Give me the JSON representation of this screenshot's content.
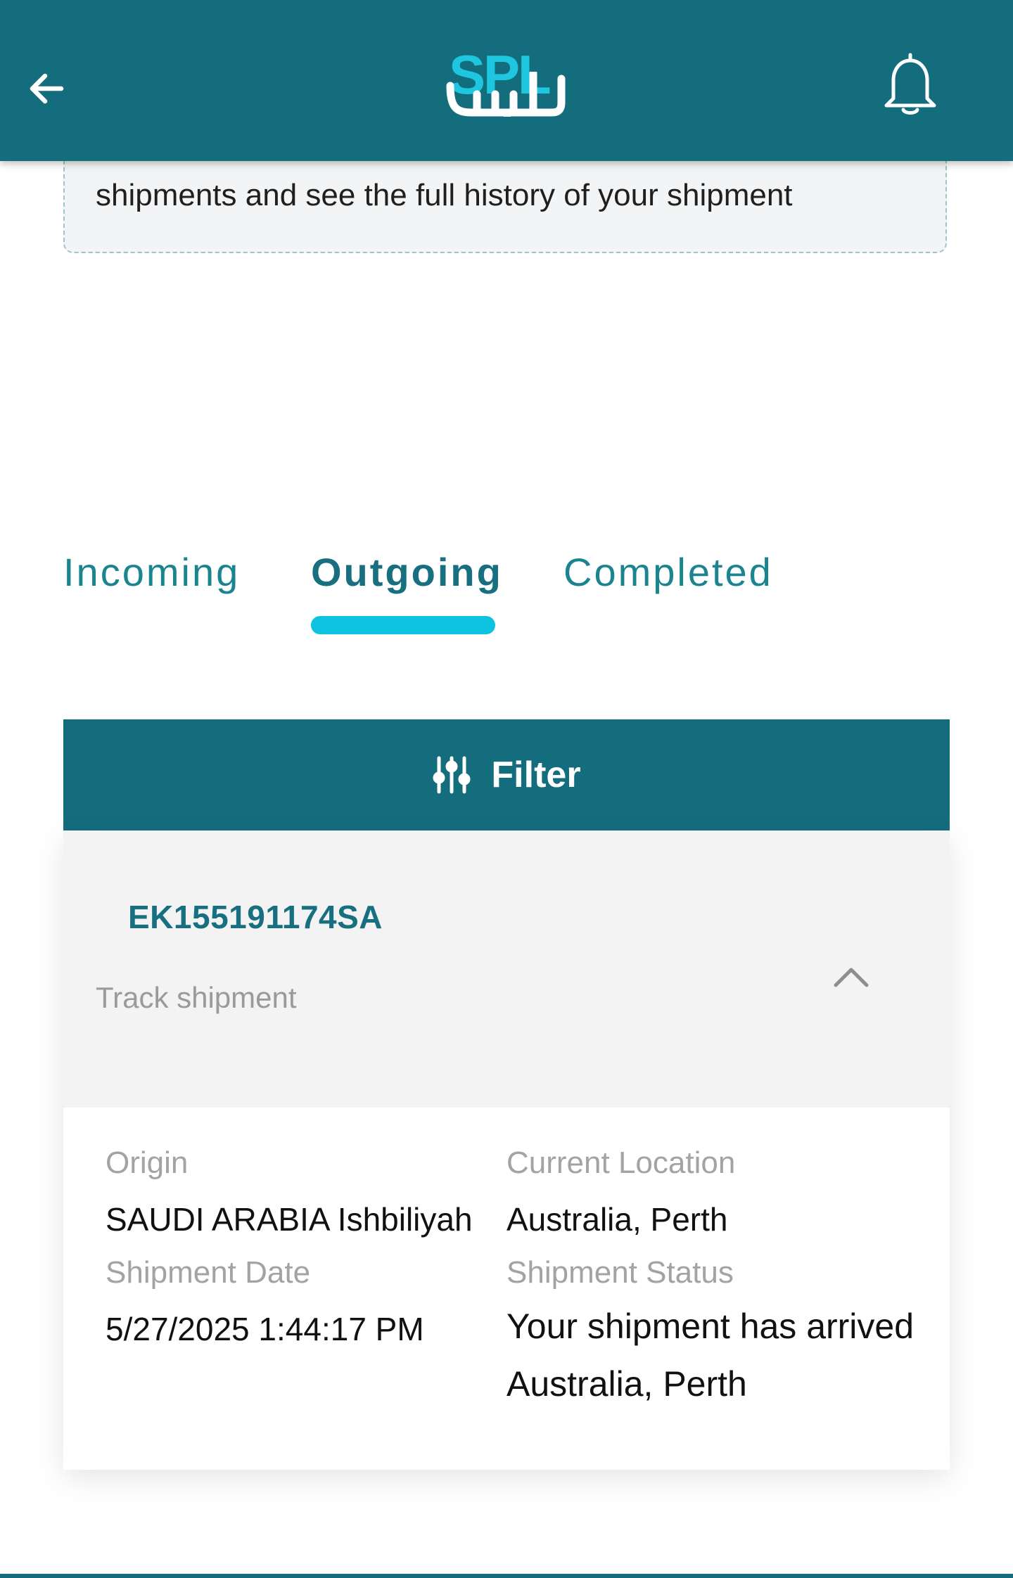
{
  "header": {
    "logo_text": "SPL",
    "logo_arabic": "سبل",
    "brand_color": "#136d7d",
    "accent_color": "#1ec6e0",
    "back_icon": "arrow-left-icon",
    "notifications_icon": "bell-icon"
  },
  "info": {
    "text": "shipments and see the full history of your shipment"
  },
  "tabs": [
    {
      "label": "Incoming",
      "active": false
    },
    {
      "label": "Outgoing",
      "active": true
    },
    {
      "label": "Completed",
      "active": false
    }
  ],
  "filter": {
    "label": "Filter",
    "icon": "sliders-icon"
  },
  "shipment": {
    "tracking_number": "EK155191174SA",
    "track_link": "Track shipment",
    "expand_icon": "chevron-up-icon",
    "fields": {
      "origin_label": "Origin",
      "origin_value": "SAUDI ARABIA Ishbiliyah",
      "current_location_label": "Current Location",
      "current_location_value": "Australia, Perth",
      "shipment_date_label": "Shipment Date",
      "shipment_date_value": "5/27/2025 1:44:17 PM",
      "shipment_status_label": "Shipment Status",
      "shipment_status_value": "Your shipment has arrived Australia, Perth"
    }
  }
}
